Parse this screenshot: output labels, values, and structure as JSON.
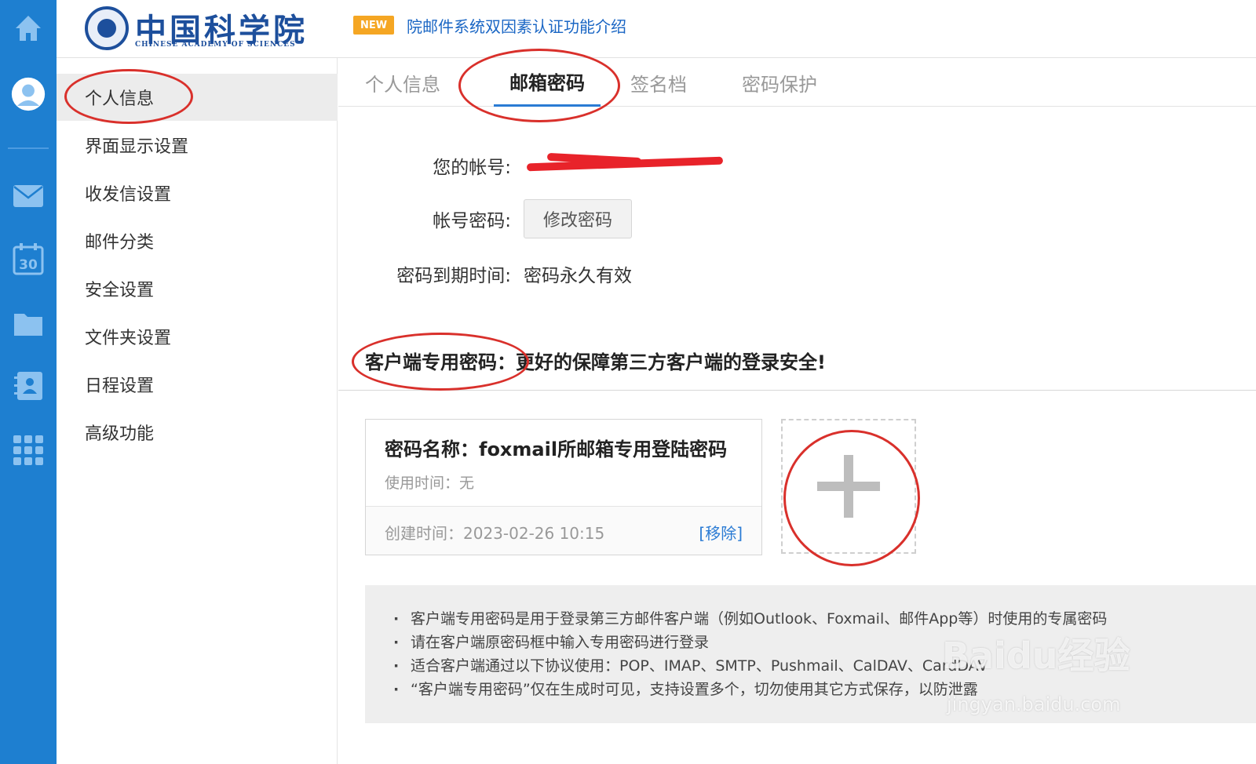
{
  "header": {
    "logo_cn": "中国科学院",
    "logo_en": "CHINESE ACADEMY OF SCIENCES",
    "new_badge": "NEW",
    "notice_link": "院邮件系统双因素认证功能介绍"
  },
  "rail": {
    "icons": [
      "home-icon",
      "avatar",
      "mail-icon",
      "calendar-icon",
      "folder-icon",
      "contacts-icon",
      "apps-grid-icon"
    ],
    "calendar_day": "30",
    "color": "#1e7fd0"
  },
  "sidebar": {
    "items": [
      {
        "label": "个人信息",
        "active": true
      },
      {
        "label": "界面显示设置",
        "active": false
      },
      {
        "label": "收发信设置",
        "active": false
      },
      {
        "label": "邮件分类",
        "active": false
      },
      {
        "label": "安全设置",
        "active": false
      },
      {
        "label": "文件夹设置",
        "active": false
      },
      {
        "label": "日程设置",
        "active": false
      },
      {
        "label": "高级功能",
        "active": false
      }
    ]
  },
  "tabs": [
    {
      "label": "个人信息",
      "active": false
    },
    {
      "label": "邮箱密码",
      "active": true
    },
    {
      "label": "签名档",
      "active": false
    },
    {
      "label": "密码保护",
      "active": false
    }
  ],
  "account": {
    "account_label": "您的帐号:",
    "password_label": "帐号密码:",
    "change_password_button": "修改密码",
    "expiry_label": "密码到期时间:",
    "expiry_value": "密码永久有效"
  },
  "client_password": {
    "title": "客户端专用密码：",
    "subtitle": "更好的保障第三方客户端的登录安全!",
    "card": {
      "name": "密码名称：foxmail所邮箱专用登陆密码",
      "used": "使用时间：无",
      "created": "创建时间：2023-02-26 10:15",
      "remove": "[移除]"
    },
    "add_icon": "plus-icon"
  },
  "info": {
    "lines": [
      "客户端专用密码是用于登录第三方邮件客户端（例如Outlook、Foxmail、邮件App等）时使用的专属密码",
      "请在客户端原密码框中输入专用密码进行登录",
      "适合客户端通过以下协议使用：POP、IMAP、SMTP、Pushmail、CalDAV、CardDAV",
      "“客户端专用密码”仅在生成时可见，支持设置多个，切勿使用其它方式保存，以防泄露"
    ]
  },
  "watermark": {
    "text": "Baidu经验",
    "url": "jingyan.baidu.com"
  },
  "colors": {
    "accent": "#2a7bd4",
    "highlight_ring": "#d9302b",
    "new_badge": "#f5a623"
  }
}
